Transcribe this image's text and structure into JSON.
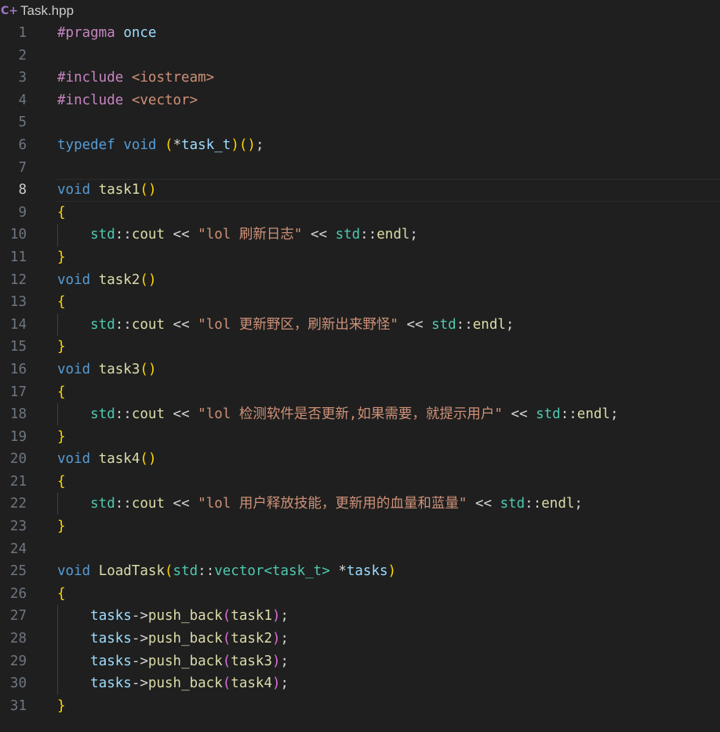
{
  "tab": {
    "icon": "cpp-header-file-icon",
    "icon_glyph": "C+",
    "file_name": "Task.hpp"
  },
  "lines": [
    {
      "n": "1",
      "tokens": [
        [
          "ctrl",
          "#pragma"
        ],
        [
          "plain",
          " "
        ],
        [
          "var",
          "once"
        ]
      ]
    },
    {
      "n": "2",
      "tokens": []
    },
    {
      "n": "3",
      "tokens": [
        [
          "ctrl",
          "#include"
        ],
        [
          "plain",
          " "
        ],
        [
          "str",
          "<iostream>"
        ]
      ]
    },
    {
      "n": "4",
      "tokens": [
        [
          "ctrl",
          "#include"
        ],
        [
          "plain",
          " "
        ],
        [
          "str",
          "<vector>"
        ]
      ]
    },
    {
      "n": "5",
      "tokens": []
    },
    {
      "n": "6",
      "tokens": [
        [
          "kw",
          "typedef"
        ],
        [
          "plain",
          " "
        ],
        [
          "kw",
          "void"
        ],
        [
          "plain",
          " "
        ],
        [
          "br1",
          "("
        ],
        [
          "op",
          "*"
        ],
        [
          "var",
          "task_t"
        ],
        [
          "br1",
          ")"
        ],
        [
          "br1",
          "("
        ],
        [
          "br1",
          ")"
        ],
        [
          "plain",
          ";"
        ]
      ]
    },
    {
      "n": "7",
      "tokens": []
    },
    {
      "n": "8",
      "current": true,
      "tokens": [
        [
          "kw",
          "void"
        ],
        [
          "plain",
          " "
        ],
        [
          "fn",
          "task1"
        ],
        [
          "br1",
          "("
        ],
        [
          "br1",
          ")"
        ]
      ]
    },
    {
      "n": "9",
      "tokens": [
        [
          "br1",
          "{"
        ]
      ]
    },
    {
      "n": "10",
      "tokens": [
        [
          "plain",
          "    "
        ],
        [
          "type",
          "std"
        ],
        [
          "plain",
          "::"
        ],
        [
          "fn",
          "cout"
        ],
        [
          "plain",
          " "
        ],
        [
          "op",
          "<<"
        ],
        [
          "plain",
          " "
        ],
        [
          "str",
          "\"lol 刷新日志\""
        ],
        [
          "plain",
          " "
        ],
        [
          "op",
          "<<"
        ],
        [
          "plain",
          " "
        ],
        [
          "type",
          "std"
        ],
        [
          "plain",
          "::"
        ],
        [
          "fn",
          "endl"
        ],
        [
          "plain",
          ";"
        ]
      ]
    },
    {
      "n": "11",
      "tokens": [
        [
          "br1",
          "}"
        ]
      ]
    },
    {
      "n": "12",
      "tokens": [
        [
          "kw",
          "void"
        ],
        [
          "plain",
          " "
        ],
        [
          "fn",
          "task2"
        ],
        [
          "br1",
          "("
        ],
        [
          "br1",
          ")"
        ]
      ]
    },
    {
      "n": "13",
      "tokens": [
        [
          "br1",
          "{"
        ]
      ]
    },
    {
      "n": "14",
      "tokens": [
        [
          "plain",
          "    "
        ],
        [
          "type",
          "std"
        ],
        [
          "plain",
          "::"
        ],
        [
          "fn",
          "cout"
        ],
        [
          "plain",
          " "
        ],
        [
          "op",
          "<<"
        ],
        [
          "plain",
          " "
        ],
        [
          "str",
          "\"lol 更新野区，刷新出来野怪\""
        ],
        [
          "plain",
          " "
        ],
        [
          "op",
          "<<"
        ],
        [
          "plain",
          " "
        ],
        [
          "type",
          "std"
        ],
        [
          "plain",
          "::"
        ],
        [
          "fn",
          "endl"
        ],
        [
          "plain",
          ";"
        ]
      ]
    },
    {
      "n": "15",
      "tokens": [
        [
          "br1",
          "}"
        ]
      ]
    },
    {
      "n": "16",
      "tokens": [
        [
          "kw",
          "void"
        ],
        [
          "plain",
          " "
        ],
        [
          "fn",
          "task3"
        ],
        [
          "br1",
          "("
        ],
        [
          "br1",
          ")"
        ]
      ]
    },
    {
      "n": "17",
      "tokens": [
        [
          "br1",
          "{"
        ]
      ]
    },
    {
      "n": "18",
      "tokens": [
        [
          "plain",
          "    "
        ],
        [
          "type",
          "std"
        ],
        [
          "plain",
          "::"
        ],
        [
          "fn",
          "cout"
        ],
        [
          "plain",
          " "
        ],
        [
          "op",
          "<<"
        ],
        [
          "plain",
          " "
        ],
        [
          "str",
          "\"lol 检测软件是否更新,如果需要，就提示用户\""
        ],
        [
          "plain",
          " "
        ],
        [
          "op",
          "<<"
        ],
        [
          "plain",
          " "
        ],
        [
          "type",
          "std"
        ],
        [
          "plain",
          "::"
        ],
        [
          "fn",
          "endl"
        ],
        [
          "plain",
          ";"
        ]
      ]
    },
    {
      "n": "19",
      "tokens": [
        [
          "br1",
          "}"
        ]
      ]
    },
    {
      "n": "20",
      "tokens": [
        [
          "kw",
          "void"
        ],
        [
          "plain",
          " "
        ],
        [
          "fn",
          "task4"
        ],
        [
          "br1",
          "("
        ],
        [
          "br1",
          ")"
        ]
      ]
    },
    {
      "n": "21",
      "tokens": [
        [
          "br1",
          "{"
        ]
      ]
    },
    {
      "n": "22",
      "tokens": [
        [
          "plain",
          "    "
        ],
        [
          "type",
          "std"
        ],
        [
          "plain",
          "::"
        ],
        [
          "fn",
          "cout"
        ],
        [
          "plain",
          " "
        ],
        [
          "op",
          "<<"
        ],
        [
          "plain",
          " "
        ],
        [
          "str",
          "\"lol 用户释放技能，更新用的血量和蓝量\""
        ],
        [
          "plain",
          " "
        ],
        [
          "op",
          "<<"
        ],
        [
          "plain",
          " "
        ],
        [
          "type",
          "std"
        ],
        [
          "plain",
          "::"
        ],
        [
          "fn",
          "endl"
        ],
        [
          "plain",
          ";"
        ]
      ]
    },
    {
      "n": "23",
      "tokens": [
        [
          "br1",
          "}"
        ]
      ]
    },
    {
      "n": "24",
      "tokens": []
    },
    {
      "n": "25",
      "tokens": [
        [
          "kw",
          "void"
        ],
        [
          "plain",
          " "
        ],
        [
          "fn",
          "LoadTask"
        ],
        [
          "br1",
          "("
        ],
        [
          "type",
          "std"
        ],
        [
          "plain",
          "::"
        ],
        [
          "type",
          "vector"
        ],
        [
          "type",
          "<"
        ],
        [
          "type",
          "task_t"
        ],
        [
          "type",
          ">"
        ],
        [
          "plain",
          " "
        ],
        [
          "op",
          "*"
        ],
        [
          "var",
          "tasks"
        ],
        [
          "br1",
          ")"
        ]
      ]
    },
    {
      "n": "26",
      "tokens": [
        [
          "br1",
          "{"
        ]
      ]
    },
    {
      "n": "27",
      "tokens": [
        [
          "plain",
          "    "
        ],
        [
          "var",
          "tasks"
        ],
        [
          "plain",
          "->"
        ],
        [
          "fn",
          "push_back"
        ],
        [
          "br2",
          "("
        ],
        [
          "fn",
          "task1"
        ],
        [
          "br2",
          ")"
        ],
        [
          "plain",
          ";"
        ]
      ]
    },
    {
      "n": "28",
      "tokens": [
        [
          "plain",
          "    "
        ],
        [
          "var",
          "tasks"
        ],
        [
          "plain",
          "->"
        ],
        [
          "fn",
          "push_back"
        ],
        [
          "br2",
          "("
        ],
        [
          "fn",
          "task2"
        ],
        [
          "br2",
          ")"
        ],
        [
          "plain",
          ";"
        ]
      ]
    },
    {
      "n": "29",
      "tokens": [
        [
          "plain",
          "    "
        ],
        [
          "var",
          "tasks"
        ],
        [
          "plain",
          "->"
        ],
        [
          "fn",
          "push_back"
        ],
        [
          "br2",
          "("
        ],
        [
          "fn",
          "task3"
        ],
        [
          "br2",
          ")"
        ],
        [
          "plain",
          ";"
        ]
      ]
    },
    {
      "n": "30",
      "tokens": [
        [
          "plain",
          "    "
        ],
        [
          "var",
          "tasks"
        ],
        [
          "plain",
          "->"
        ],
        [
          "fn",
          "push_back"
        ],
        [
          "br2",
          "("
        ],
        [
          "fn",
          "task4"
        ],
        [
          "br2",
          ")"
        ],
        [
          "plain",
          ";"
        ]
      ]
    },
    {
      "n": "31",
      "tokens": [
        [
          "br1",
          "}"
        ]
      ]
    }
  ]
}
